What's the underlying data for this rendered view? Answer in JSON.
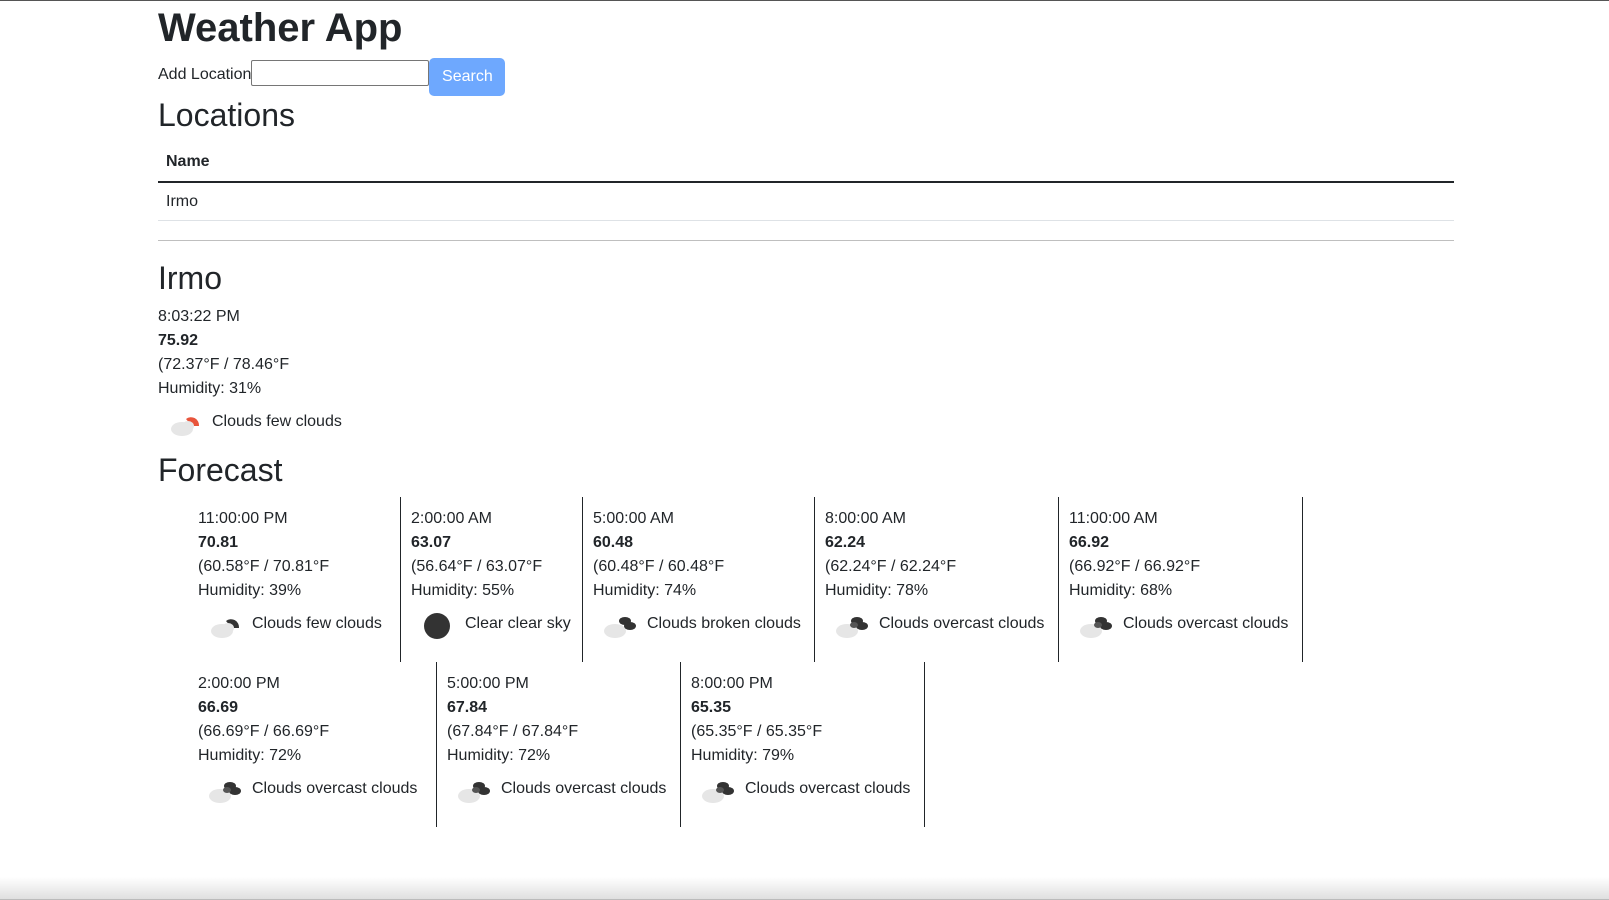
{
  "app": {
    "title": "Weather App"
  },
  "search": {
    "label": "Add Location",
    "value": "",
    "placeholder": "",
    "button_label": "Search"
  },
  "locations": {
    "heading": "Locations",
    "column_header": "Name",
    "rows": [
      "Irmo"
    ]
  },
  "current": {
    "city": "Irmo",
    "time": "8:03:22 PM",
    "temp": "75.92",
    "range": "(72.37°F / 78.46°F",
    "humidity": "Humidity: 31%",
    "condition": "Clouds few clouds",
    "icon": "few-clouds-night-icon"
  },
  "forecast": {
    "heading": "Forecast",
    "items": [
      {
        "time": "11:00:00 PM",
        "temp": "70.81",
        "range": "(60.58°F / 70.81°F",
        "humidity": "Humidity: 39%",
        "condition": "Clouds few clouds",
        "icon": "few-clouds-icon"
      },
      {
        "time": "2:00:00 AM",
        "temp": "63.07",
        "range": "(56.64°F / 63.07°F",
        "humidity": "Humidity: 55%",
        "condition": "Clear clear sky",
        "icon": "clear-sky-icon"
      },
      {
        "time": "5:00:00 AM",
        "temp": "60.48",
        "range": "(60.48°F / 60.48°F",
        "humidity": "Humidity: 74%",
        "condition": "Clouds broken clouds",
        "icon": "broken-clouds-icon"
      },
      {
        "time": "8:00:00 AM",
        "temp": "62.24",
        "range": "(62.24°F / 62.24°F",
        "humidity": "Humidity: 78%",
        "condition": "Clouds overcast clouds",
        "icon": "overcast-clouds-icon"
      },
      {
        "time": "11:00:00 AM",
        "temp": "66.92",
        "range": "(66.92°F / 66.92°F",
        "humidity": "Humidity: 68%",
        "condition": "Clouds overcast clouds",
        "icon": "overcast-clouds-icon"
      },
      {
        "time": "2:00:00 PM",
        "temp": "66.69",
        "range": "(66.69°F / 66.69°F",
        "humidity": "Humidity: 72%",
        "condition": "Clouds overcast clouds",
        "icon": "overcast-clouds-icon"
      },
      {
        "time": "5:00:00 PM",
        "temp": "67.84",
        "range": "(67.84°F / 67.84°F",
        "humidity": "Humidity: 72%",
        "condition": "Clouds overcast clouds",
        "icon": "overcast-clouds-icon"
      },
      {
        "time": "8:00:00 PM",
        "temp": "65.35",
        "range": "(65.35°F / 65.35°F",
        "humidity": "Humidity: 79%",
        "condition": "Clouds overcast clouds",
        "icon": "overcast-clouds-icon"
      }
    ]
  },
  "colors": {
    "button": "#6ea8fe",
    "sun_accent": "#e8543b",
    "dark": "#333333",
    "cloud": "#dddddd"
  }
}
